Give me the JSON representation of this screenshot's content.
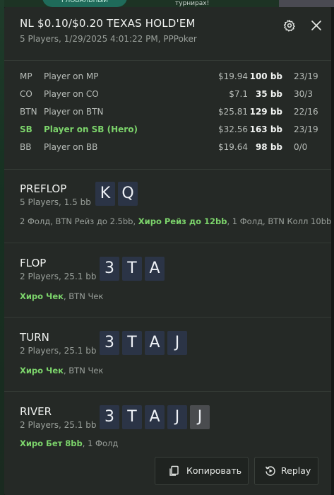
{
  "background": {
    "badge_text": "ГЛОБАЛЬНЫЙ",
    "hint_text": "турниpax!"
  },
  "header": {
    "title": "NL $0.10/$0.20 TEXAS HOLD'EM",
    "subtitle": "5 Players, 1/29/2025 4:01:22 PM, PPPoker"
  },
  "players": [
    {
      "pos": "MP",
      "name": "Player on MP",
      "stack": "$19.94",
      "bb": "100 bb",
      "ratio": "23/19"
    },
    {
      "pos": "CO",
      "name": "Player on CO",
      "stack": "$7.1",
      "bb": "35 bb",
      "ratio": "30/3"
    },
    {
      "pos": "BTN",
      "name": "Player on BTN",
      "stack": "$25.81",
      "bb": "129 bb",
      "ratio": "22/16"
    },
    {
      "pos": "SB",
      "name": "Player on SB (Hero)",
      "stack": "$32.56",
      "bb": "163 bb",
      "ratio": "23/19"
    },
    {
      "pos": "BB",
      "name": "Player on BB",
      "stack": "$19.64",
      "bb": "98 bb",
      "ratio": "0/0"
    }
  ],
  "streets": {
    "preflop": {
      "name": "PREFLOP",
      "info": "5 Players, 1.5 bb",
      "cards": [
        "K",
        "Q"
      ],
      "actions_a": "2 Фолд, BTN Рейз до 2.5bb, ",
      "actions_hero": "Хиро Рейз до 12bb",
      "actions_b": ", 1 Фолд, BTN Колл 10bb"
    },
    "flop": {
      "name": "FLOP",
      "info": "2 Players, 25.1 bb",
      "cards": [
        "3",
        "T",
        "A"
      ],
      "actions_hero": "Хиро Чек",
      "actions_b": ", BTN Чек"
    },
    "turn": {
      "name": "TURN",
      "info": "2 Players, 25.1 bb",
      "cards": [
        "3",
        "T",
        "A",
        "J"
      ],
      "actions_hero": "Хиро Чек",
      "actions_b": ", BTN Чек"
    },
    "river": {
      "name": "RIVER",
      "info": "2 Players, 25.1 bb",
      "cards": [
        "3",
        "T",
        "A",
        "J"
      ],
      "new_card": "J",
      "actions_hero": "Хиро Бет 8bb",
      "actions_b": ", 1 Фолд"
    }
  },
  "footer": {
    "copy_label": "Копировать",
    "replay_label": "Replay"
  },
  "colors": {
    "hero": "#7cd46b",
    "card": "#2b3446",
    "panel": "#252926"
  }
}
